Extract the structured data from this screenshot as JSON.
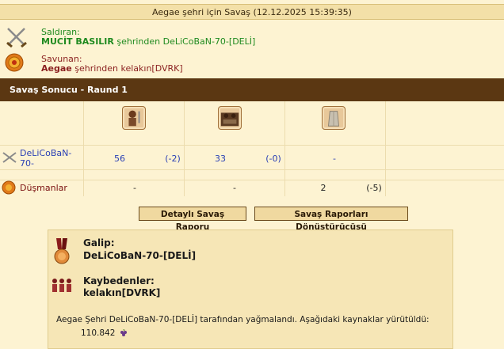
{
  "title": "Aegae şehri için Savaş (12.12.2025 15:39:35)",
  "attacker": {
    "label": "Saldıran:",
    "name": "MUCİT BASILIR",
    "from_text": "şehrinden DeLiCoBaN-70-[DELİ]"
  },
  "defender": {
    "label": "Savunan:",
    "name": "Aegae",
    "from_text": "şehrinden kelakın[DVRK]"
  },
  "section_title": "Savaş Sonucu - Raund 1",
  "units": [
    {
      "icon": "hoplite-unit-icon"
    },
    {
      "icon": "archer-unit-icon"
    },
    {
      "icon": "wall-icon"
    }
  ],
  "rows": [
    {
      "name": "DeLiCoBaN-70-",
      "cells": [
        {
          "value": "56",
          "loss": "(-2)"
        },
        {
          "value": "33",
          "loss": "(-0)"
        },
        {
          "value": "-",
          "loss": ""
        }
      ]
    },
    {
      "name": "Düşmanlar",
      "cells": [
        {
          "value": "-",
          "loss": ""
        },
        {
          "value": "-",
          "loss": ""
        },
        {
          "value": "2",
          "loss": "(-5)"
        }
      ]
    }
  ],
  "buttons": {
    "detailed_report": "Detaylı Savaş Raporu",
    "converter": "Savaş Raporları Dönüştürücüsü"
  },
  "result": {
    "winner_label": "Galip:",
    "winner_name": "DeLiCoBaN-70-[DELİ]",
    "loser_label": "Kaybedenler:",
    "loser_name": "kelakın[DVRK]",
    "loot_text": "Aegae Şehri DeLiCoBaN-70-[DELİ] tarafından yağmalandı. Aşağıdaki kaynaklar yürütüldü:",
    "loot_amount": "110.842"
  },
  "colors": {
    "header_bar": "#5b3712",
    "title_bg": "#f3e0a8",
    "page_bg": "#fdf3d2",
    "attacker_text": "#1f8a1f",
    "defender_text": "#8a1f1f",
    "player_link": "#2a3fb5"
  }
}
